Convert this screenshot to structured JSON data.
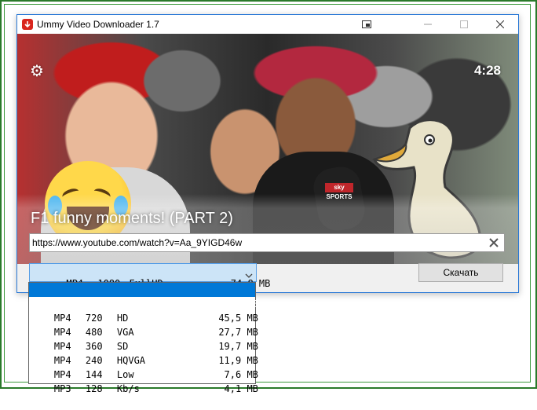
{
  "window": {
    "title": "Ummy Video Downloader 1.7"
  },
  "preview": {
    "duration": "4:28",
    "video_title": "F1 funny moments! (PART 2)",
    "mic_label": "sky SPORTS"
  },
  "url_field": {
    "value": "https://www.youtube.com/watch?v=Aa_9YIGD46w"
  },
  "format_select": {
    "selected": {
      "container": "MP4",
      "resolution": "1080",
      "quality": "FullHD",
      "size": "74,8 MB"
    }
  },
  "download_button": {
    "label": "Скачать"
  },
  "dropdown": {
    "options": [
      {
        "container": "MP4",
        "resolution": "1080",
        "quality": "FullHD",
        "size": "74,8 MB"
      },
      {
        "container": "MP4",
        "resolution": "720",
        "quality": "HD",
        "size": "45,5 MB"
      },
      {
        "container": "MP4",
        "resolution": "480",
        "quality": "VGA",
        "size": "27,7 MB"
      },
      {
        "container": "MP4",
        "resolution": "360",
        "quality": "SD",
        "size": "19,7 MB"
      },
      {
        "container": "MP4",
        "resolution": "240",
        "quality": "HQVGA",
        "size": "11,9 MB"
      },
      {
        "container": "MP4",
        "resolution": "144",
        "quality": "Low",
        "size": "7,6 MB"
      },
      {
        "container": "MP3",
        "resolution": "128",
        "quality": "Kb/s",
        "size": "4,1 MB"
      }
    ],
    "selected_index": 0
  },
  "icons": {
    "app": "download-icon",
    "settings": "gear-icon",
    "clear": "close-icon",
    "dropdown": "chevron-down-icon"
  },
  "colors": {
    "accent": "#0078d7",
    "select_bg": "#cce4f7",
    "app_icon": "#d9251d"
  }
}
